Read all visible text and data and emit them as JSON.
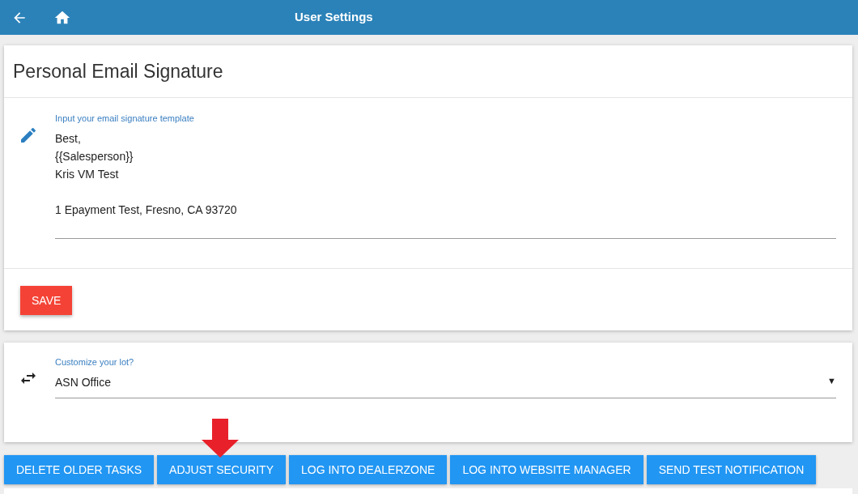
{
  "header": {
    "title": "User Settings"
  },
  "signature_card": {
    "title": "Personal Email Signature",
    "field_label": "Input your email signature template",
    "value": "Best,\n{{Salesperson}}\nKris VM Test\n\n1 Epayment Test, Fresno, CA 93720",
    "save_label": "SAVE"
  },
  "lot_card": {
    "field_label": "Customize your lot?",
    "value": "ASN Office",
    "caret": "▼"
  },
  "actions": [
    {
      "label": "DELETE OLDER TASKS",
      "highlighted": false
    },
    {
      "label": "ADJUST SECURITY",
      "highlighted": true
    },
    {
      "label": "LOG INTO DEALERZONE",
      "highlighted": false
    },
    {
      "label": "LOG INTO WEBSITE MANAGER",
      "highlighted": false
    },
    {
      "label": "SEND TEST NOTIFICATION",
      "highlighted": false
    }
  ]
}
